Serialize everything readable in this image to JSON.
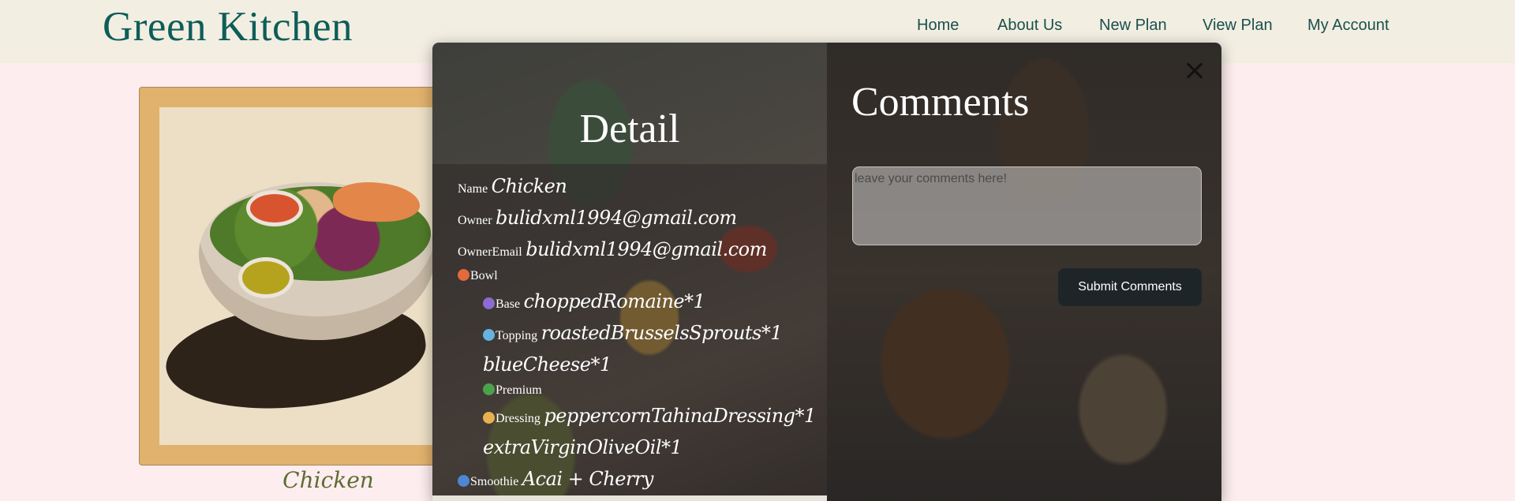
{
  "header": {
    "logo": "Green Kitchen",
    "nav": [
      "Home",
      "About Us",
      "New Plan",
      "View Plan",
      "My Account"
    ]
  },
  "card": {
    "caption": "Chicken"
  },
  "detail": {
    "title": "Detail",
    "name_label": "Name",
    "name_value": "Chicken",
    "owner_label": "Owner",
    "owner_value": "bulidxml1994@gmail.com",
    "owner_email_label": "OwnerEmail",
    "owner_email_value": "bulidxml1994@gmail.com",
    "bowl_label": "Bowl",
    "base_label": "Base",
    "base_value": "choppedRomaine*1",
    "topping_label": "Topping",
    "topping_value_1": "roastedBrusselsSprouts*1",
    "topping_value_2": "blueCheese*1",
    "premium_label": "Premium",
    "dressing_label": "Dressing",
    "dressing_value_1": "peppercornTahinaDressing*1",
    "dressing_value_2": "extraVirginOliveOil*1",
    "smoothie_label": "Smoothie",
    "smoothie_value": "Acai + Cherry"
  },
  "comments": {
    "title": "Comments",
    "placeholder": "leave your comments here!",
    "submit_label": "Submit Comments",
    "close_icon": "close-icon"
  },
  "colors": {
    "page_bg": "#fdedef",
    "navbar_bg": "#f3eee2",
    "logo": "#0e5d58",
    "card_frame": "#e1b26d",
    "submit_bg": "#1e2528"
  }
}
